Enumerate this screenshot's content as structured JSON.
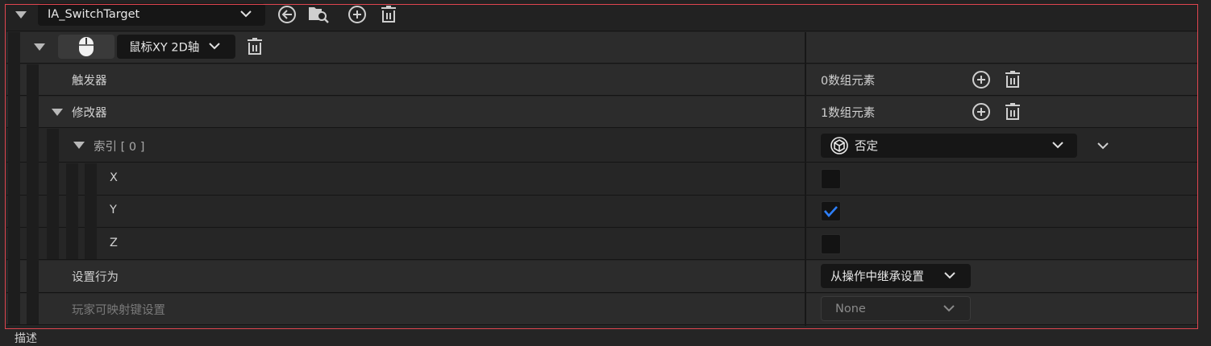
{
  "header": {
    "action_name": "IA_SwitchTarget",
    "icons": [
      "arrow-back-circle-icon",
      "browse-folder-icon",
      "add-circle-icon",
      "trash-icon"
    ]
  },
  "mapping": {
    "device_icon": "mouse-icon",
    "key_label": "鼠标XY 2D轴"
  },
  "rows": {
    "triggers": {
      "label": "触发器",
      "value": "0数组元素"
    },
    "modifiers": {
      "label": "修改器",
      "value": "1数组元素"
    },
    "index": {
      "label": "索引 [ 0 ]",
      "value": "否定",
      "icon": "cube-icon"
    },
    "x": {
      "label": "X",
      "checked": false
    },
    "y": {
      "label": "Y",
      "checked": true
    },
    "z": {
      "label": "Z",
      "checked": false
    },
    "behavior": {
      "label": "设置行为",
      "value": "从操作中继承设置"
    },
    "player_mappable": {
      "label": "玩家可映射键设置",
      "value": "None"
    }
  },
  "footer": {
    "partial_label": "描述"
  },
  "colors": {
    "accent": "#2d7ff9",
    "frame": "#e0454f"
  }
}
